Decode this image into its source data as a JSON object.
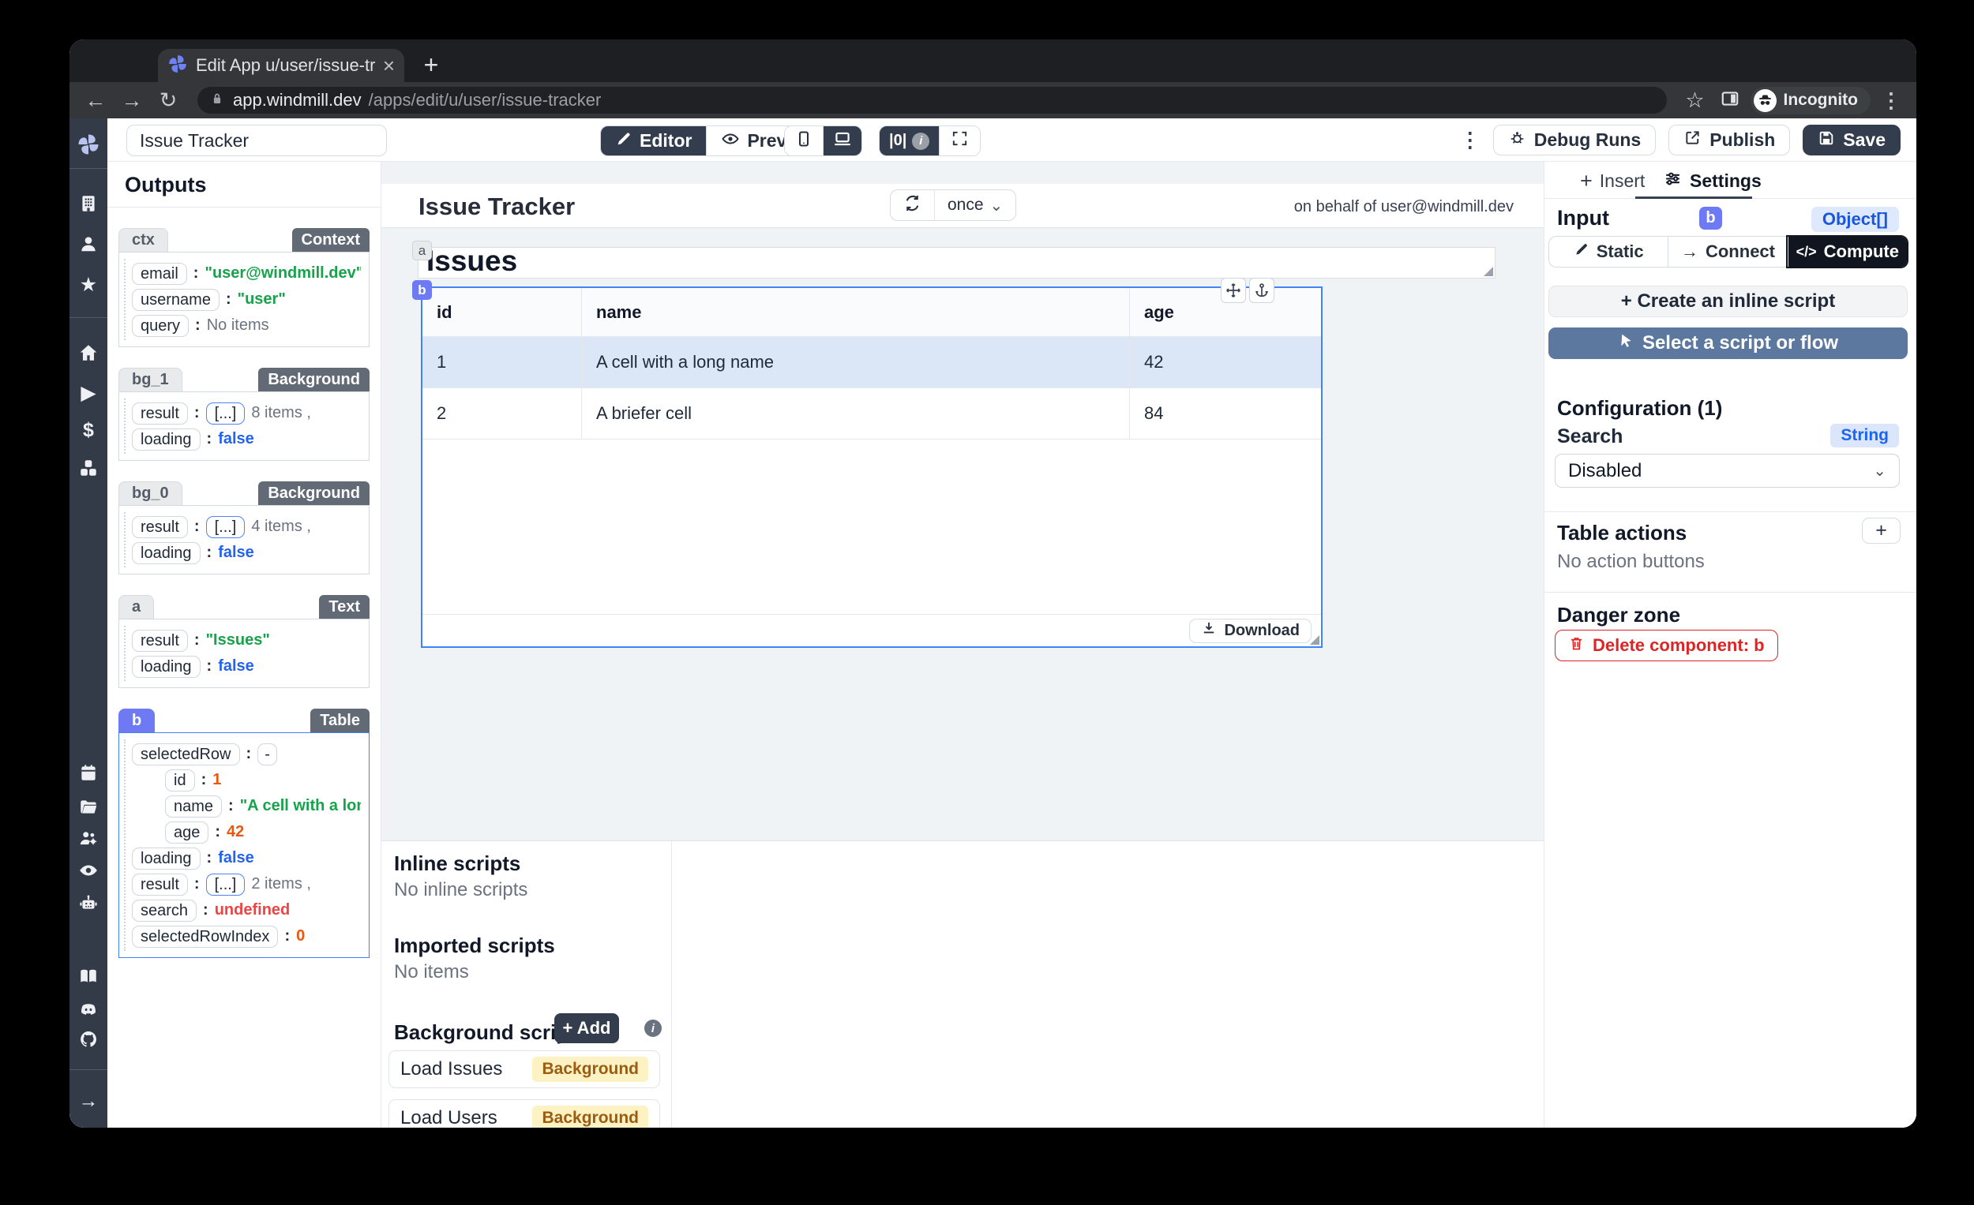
{
  "browser": {
    "tab_title": "Edit App u/user/issue-tracker |",
    "url_host": "app.windmill.dev",
    "url_path": "/apps/edit/u/user/issue-tracker",
    "incognito_label": "Incognito"
  },
  "glyphs": {
    "close": "×",
    "new_tab": "+",
    "back": "←",
    "forward": "→",
    "reload": "↻",
    "dots": "⋮",
    "star_outline": "☆",
    "chevron_down": "⌄",
    "info": "i",
    "pipe_zero": "|0|",
    "code": "</>",
    "arrow": "→",
    "star": "★",
    "play": "▶",
    "dollar": "$",
    "plus": "+"
  },
  "appbar": {
    "app_name": "Issue Tracker",
    "editor": "Editor",
    "preview": "Preview",
    "debug_runs": "Debug Runs",
    "publish": "Publish",
    "save": "Save"
  },
  "outputs": {
    "heading": "Outputs",
    "sections": [
      {
        "id": "ctx",
        "badge": "Context",
        "rows": [
          {
            "key": "email",
            "value": "\"user@windmill.dev\""
          },
          {
            "key": "username",
            "value": "\"user\""
          },
          {
            "key": "query",
            "value": "No items"
          }
        ]
      },
      {
        "id": "bg_1",
        "badge": "Background",
        "rows": [
          {
            "key": "result",
            "bracket": "[...]",
            "value": "8 items ,"
          },
          {
            "key": "loading",
            "value": "false"
          }
        ]
      },
      {
        "id": "bg_0",
        "badge": "Background",
        "rows": [
          {
            "key": "result",
            "bracket": "[...]",
            "value": "4 items ,"
          },
          {
            "key": "loading",
            "value": "false"
          }
        ]
      },
      {
        "id": "a",
        "badge": "Text",
        "rows": [
          {
            "key": "result",
            "value": "\"Issues\""
          },
          {
            "key": "loading",
            "value": "false"
          }
        ]
      },
      {
        "id": "b",
        "badge": "Table",
        "rows": [
          {
            "key": "selectedRow",
            "value": "-"
          },
          {
            "key": "id",
            "value": "1"
          },
          {
            "key": "name",
            "value": "\"A cell with a long name\""
          },
          {
            "key": "age",
            "value": "42"
          },
          {
            "key": "loading",
            "value": "false"
          },
          {
            "key": "result",
            "bracket": "[...]",
            "value": "2 items ,"
          },
          {
            "key": "search",
            "value": "undefined"
          },
          {
            "key": "selectedRowIndex",
            "value": "0"
          }
        ]
      }
    ]
  },
  "canvas": {
    "title": "Issue Tracker",
    "refresh_mode": "once",
    "on_behalf": "on behalf of user@windmill.dev",
    "text_component": {
      "tag": "a",
      "text": "Issues"
    },
    "table": {
      "tag": "b",
      "columns": [
        "id",
        "name",
        "age"
      ],
      "rows": [
        {
          "id": "1",
          "name": "A cell with a long name",
          "age": "42"
        },
        {
          "id": "2",
          "name": "A briefer cell",
          "age": "84"
        }
      ],
      "download": "Download"
    }
  },
  "scripts_panel": {
    "inline_heading": "Inline scripts",
    "inline_empty": "No inline scripts",
    "imported_heading": "Imported scripts",
    "imported_empty": "No items",
    "background_heading": "Background scripts",
    "add_button": "+ Add",
    "items": [
      {
        "name": "Load Issues",
        "badge": "Background"
      },
      {
        "name": "Load Users",
        "badge": "Background"
      }
    ]
  },
  "settings": {
    "insert_tab": "Insert",
    "settings_tab": "Settings",
    "input_label": "Input",
    "component_id": "b",
    "type_badge": "Object[]",
    "mode_static": "Static",
    "mode_connect": "Connect",
    "mode_compute": "Compute",
    "create_inline": "+ Create an inline script",
    "select_script": "Select a script or flow",
    "config_heading": "Configuration (1)",
    "search_label": "Search",
    "search_type": "String",
    "search_value": "Disabled",
    "table_actions_heading": "Table actions",
    "table_actions_empty": "No action buttons",
    "danger_heading": "Danger zone",
    "delete_button": "Delete component: b"
  },
  "colors": {
    "accent_indigo": "#6e79f4",
    "selection_blue": "#3f83f8",
    "string_green": "#16a34a",
    "bool_blue": "#2563eb",
    "number_orange": "#ea580c",
    "error_red": "#ef4444",
    "badge_yellow_bg": "#fdf2c4",
    "dark_button": "#343d4d",
    "select_script_bg": "#5c789e"
  }
}
